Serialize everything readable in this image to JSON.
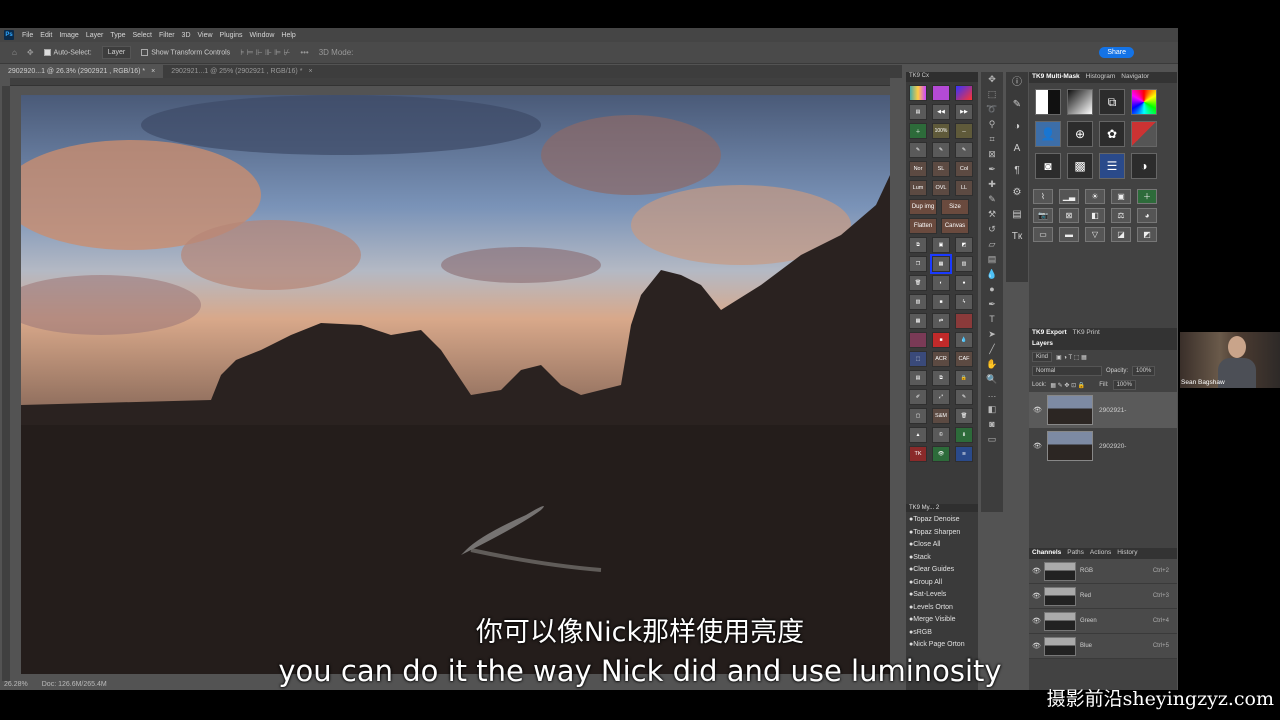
{
  "menubar": {
    "logo": "Ps",
    "items": [
      "File",
      "Edit",
      "Image",
      "Layer",
      "Type",
      "Select",
      "Filter",
      "3D",
      "View",
      "Plugins",
      "Window",
      "Help"
    ]
  },
  "options_bar": {
    "auto_select_label": "Auto-Select:",
    "auto_select_value": "Layer",
    "transform_label": "Show Transform Controls",
    "mode_3d": "3D Mode:",
    "share_label": "Share"
  },
  "tabs": [
    {
      "label": "2902920...1 @ 26.3% (2902921 , RGB/16) *"
    },
    {
      "label": "2902921...1 @ 25% (2902921 , RGB/16) *"
    }
  ],
  "status": {
    "zoom": "26.28%",
    "doc": "Doc: 126.6M/265.4M"
  },
  "tk9cx": {
    "title": "TK9 Cx",
    "labeled": {
      "pct": "100%",
      "nor": "Nor",
      "sl": "SL",
      "col": "Col",
      "scr": "Scr",
      "lum": "Lum",
      "ovl": "OVL",
      "ll": "LL",
      "mul": "Mul",
      "acr": "ACR",
      "caf": "CAF",
      "sm": "S&M",
      "tk": "TK"
    },
    "pairs": [
      [
        "Dup img",
        "Size"
      ],
      [
        "Flatten",
        "Canvas"
      ]
    ]
  },
  "tk9my": {
    "title": "TK9 My...",
    "page": "2",
    "items": [
      "Topaz Denoise",
      "Topaz Sharpen",
      "Close All",
      "Stack",
      "Clear Guides",
      "Group All",
      "Sat-Levels",
      "Levels Orton",
      "Merge Visible",
      "sRGB",
      "Nick Page Orton"
    ]
  },
  "right": {
    "multimask_tabs": [
      "TK9 Multi-Mask",
      "Histogram",
      "Navigator"
    ],
    "export_tabs": [
      "TK9 Export",
      "TK9 Print"
    ],
    "layers_title": "Layers",
    "kind": "Kind",
    "blend": "Normal",
    "opacity_label": "Opacity:",
    "opacity": "100%",
    "lock_label": "Lock:",
    "fill_label": "Fill:",
    "fill": "100%",
    "layers": [
      {
        "name": "2902921-",
        "selected": true
      },
      {
        "name": "2902920-",
        "selected": false
      }
    ],
    "channel_tabs": [
      "Channels",
      "Paths",
      "Actions",
      "History"
    ],
    "channels": [
      {
        "name": "RGB",
        "shortcut": "Ctrl+2"
      },
      {
        "name": "Red",
        "shortcut": "Ctrl+3"
      },
      {
        "name": "Green",
        "shortcut": "Ctrl+4"
      },
      {
        "name": "Blue",
        "shortcut": "Ctrl+5"
      }
    ]
  },
  "webcam": {
    "name": "Sean Bagshaw"
  },
  "subtitles": {
    "zh": "你可以像Nick那样使用亮度",
    "en": "you can do it the way Nick did and use luminosity"
  },
  "watermark": "摄影前沿sheyingzyz.com"
}
